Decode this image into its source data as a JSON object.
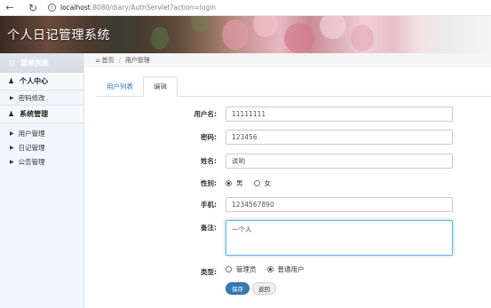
{
  "browser": {
    "url_host": "localhost",
    "url_path": ":8080/diary/AuthServlet?action=login"
  },
  "banner": {
    "title": "个人日记管理系统"
  },
  "sidebar": {
    "header": "菜单列表",
    "sections": [
      {
        "title": "个人中心",
        "items": [
          {
            "label": "密码修改"
          }
        ]
      },
      {
        "title": "系统管理",
        "items": [
          {
            "label": "用户管理"
          },
          {
            "label": "日记管理"
          },
          {
            "label": "公告管理"
          }
        ]
      }
    ]
  },
  "breadcrumb": {
    "home": "首页",
    "current": "用户管理"
  },
  "tabs": [
    {
      "label": "用户列表",
      "active": false
    },
    {
      "label": "编辑",
      "active": true
    }
  ],
  "form": {
    "username": {
      "label": "用户名:",
      "value": "11111111"
    },
    "password": {
      "label": "密码:",
      "value": "123456"
    },
    "name": {
      "label": "姓名:",
      "value": "诶哟"
    },
    "gender": {
      "label": "性别:",
      "options": [
        "男",
        "女"
      ],
      "selected": "男"
    },
    "phone": {
      "label": "手机:",
      "value": "1234567890"
    },
    "remark": {
      "label": "备注:",
      "value": "一个人"
    },
    "type": {
      "label": "类型:",
      "options": [
        "管理员",
        "普通用户"
      ],
      "selected": "普通用户"
    },
    "save_label": "保存",
    "back_label": "返回"
  }
}
